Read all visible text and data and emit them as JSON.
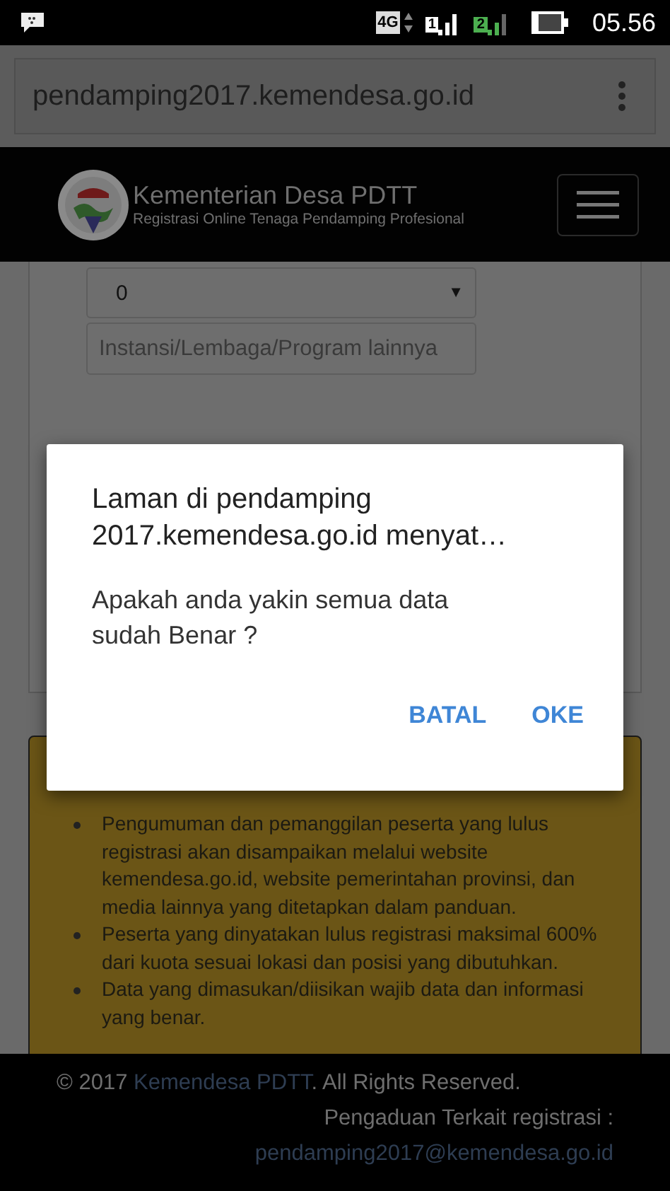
{
  "status_bar": {
    "network": "4G",
    "sim1": "1",
    "sim2": "2",
    "time": "05.56"
  },
  "browser": {
    "url": "pendamping2017.kemendesa.go.id"
  },
  "header": {
    "title": "Kementerian Desa PDTT",
    "subtitle": "Registrasi Online Tenaga Pendamping Profesional"
  },
  "form": {
    "select_value": "0",
    "select_arrow": "▼",
    "other_placeholder": "Instansi/Lembaga/Program lainnya"
  },
  "announcement": {
    "items": [
      "Pengumuman dan pemanggilan peserta yang lulus registrasi akan disampaikan melalui website kemendesa.go.id, website pemerintahan provinsi, dan media lainnya yang ditetapkan dalam panduan.",
      "Peserta yang dinyatakan lulus registrasi maksimal 600% dari kuota sesuai lokasi dan posisi yang dibutuhkan.",
      "Data yang dimasukan/diisikan wajib data dan informasi yang benar."
    ]
  },
  "footer": {
    "copyright_prefix": "© 2017 ",
    "copyright_link": "Kemendesa PDTT",
    "copyright_suffix": ". All Rights Reserved.",
    "complaint_label": "Pengaduan Terkait registrasi :",
    "email": "pendamping2017@kemendesa.go.id"
  },
  "dialog": {
    "title_lines": [
      "Laman di pendamping",
      "2017.kemendesa.go.id menyat…"
    ],
    "message_lines": [
      "Apakah anda yakin semua data",
      "sudah Benar ?"
    ],
    "buttons": [
      "BATAL",
      "OKE"
    ]
  }
}
